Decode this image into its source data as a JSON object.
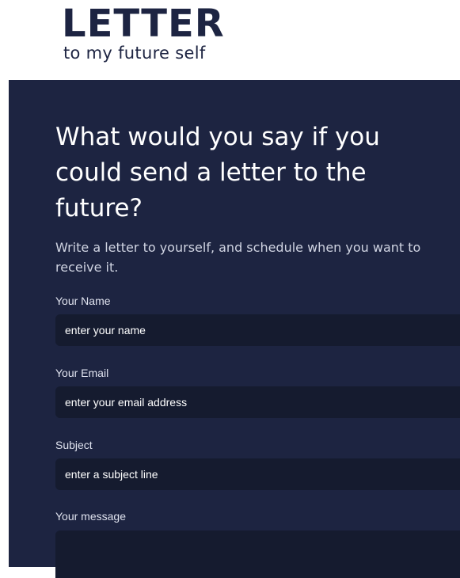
{
  "logo": {
    "title": "LETTER",
    "subtitle": "to my future self"
  },
  "hero": {
    "headline": "What would you say if you could send a letter to the future?",
    "intro": "Write a letter to yourself, and schedule when you want to receive it."
  },
  "form": {
    "name": {
      "label": "Your Name",
      "placeholder": "enter your name"
    },
    "email": {
      "label": "Your Email",
      "placeholder": "enter your email address"
    },
    "subject": {
      "label": "Subject",
      "placeholder": "enter a subject line"
    },
    "message": {
      "label": "Your message",
      "placeholder": ""
    }
  },
  "colors": {
    "brand_navy": "#1d2442",
    "panel_bg": "#1d2441",
    "input_bg": "#151b2f",
    "text_white": "#ffffff"
  }
}
